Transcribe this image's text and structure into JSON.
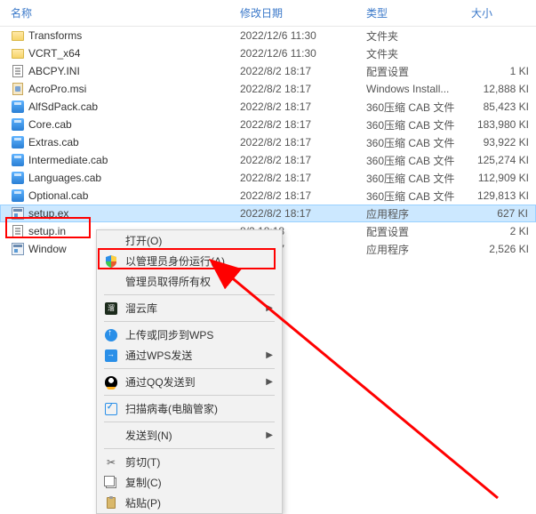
{
  "header": {
    "name": "名称",
    "date": "修改日期",
    "type": "类型",
    "size": "大小"
  },
  "files": [
    {
      "name": "Transforms",
      "date": "2022/12/6 11:30",
      "type": "文件夹",
      "size": "",
      "icon": "folder"
    },
    {
      "name": "VCRT_x64",
      "date": "2022/12/6 11:30",
      "type": "文件夹",
      "size": "",
      "icon": "folder"
    },
    {
      "name": "ABCPY.INI",
      "date": "2022/8/2 18:17",
      "type": "配置设置",
      "size": "1 KI",
      "icon": "ini"
    },
    {
      "name": "AcroPro.msi",
      "date": "2022/8/2 18:17",
      "type": "Windows Install...",
      "size": "12,888 KI",
      "icon": "msi"
    },
    {
      "name": "AlfSdPack.cab",
      "date": "2022/8/2 18:17",
      "type": "360压缩 CAB 文件",
      "size": "85,423 KI",
      "icon": "cab"
    },
    {
      "name": "Core.cab",
      "date": "2022/8/2 18:17",
      "type": "360压缩 CAB 文件",
      "size": "183,980 KI",
      "icon": "cab"
    },
    {
      "name": "Extras.cab",
      "date": "2022/8/2 18:17",
      "type": "360压缩 CAB 文件",
      "size": "93,922 KI",
      "icon": "cab"
    },
    {
      "name": "Intermediate.cab",
      "date": "2022/8/2 18:17",
      "type": "360压缩 CAB 文件",
      "size": "125,274 KI",
      "icon": "cab"
    },
    {
      "name": "Languages.cab",
      "date": "2022/8/2 18:17",
      "type": "360压缩 CAB 文件",
      "size": "112,909 KI",
      "icon": "cab"
    },
    {
      "name": "Optional.cab",
      "date": "2022/8/2 18:17",
      "type": "360压缩 CAB 文件",
      "size": "129,813 KI",
      "icon": "cab"
    },
    {
      "name": "setup.ex",
      "date": "2022/8/2 18:17",
      "type": "应用程序",
      "size": "627 KI",
      "icon": "exe",
      "selected": true
    },
    {
      "name": "setup.in",
      "date": "8/2 18:18",
      "type": "配置设置",
      "size": "2 KI",
      "icon": "ini"
    },
    {
      "name": "Window",
      "date": "8/2 18:17",
      "type": "应用程序",
      "size": "2,526 KI",
      "icon": "exe"
    }
  ],
  "menu": {
    "open": "打开(O)",
    "runas_admin": "以管理员身份运行(A)",
    "admin_take": "管理员取得所有权",
    "liuyun": "溜云库",
    "wps_upload": "上传或同步到WPS",
    "wps_send": "通过WPS发送",
    "qq_send": "通过QQ发送到",
    "scan_virus": "扫描病毒(电脑管家)",
    "send_to": "发送到(N)",
    "cut": "剪切(T)",
    "copy": "复制(C)",
    "paste": "粘贴(P)"
  }
}
